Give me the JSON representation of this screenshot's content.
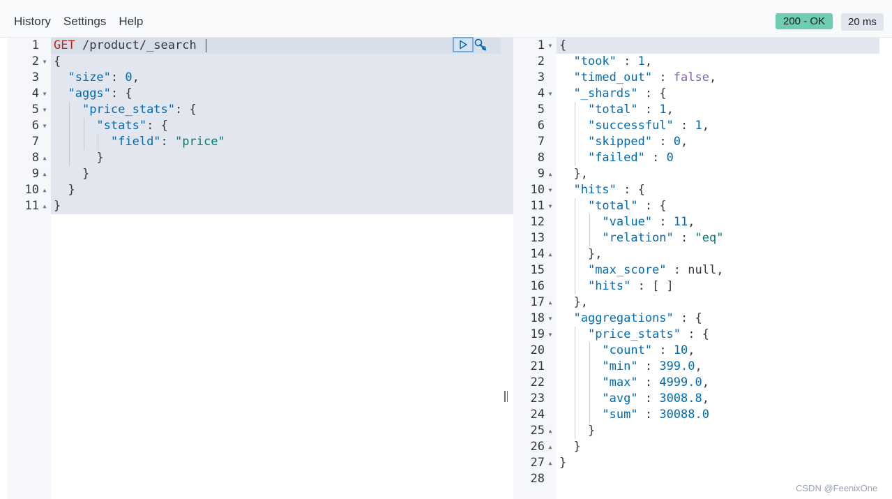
{
  "menu": {
    "items": [
      "History",
      "Settings",
      "Help"
    ]
  },
  "status": {
    "code": "200 - OK",
    "timing": "20 ms"
  },
  "request": {
    "method": "GET",
    "url": "/product/_search",
    "lines": [
      [
        [
          "method",
          "GET"
        ],
        [
          "p",
          " "
        ],
        [
          "url",
          "/product/_search"
        ]
      ],
      [
        [
          "p",
          "{"
        ]
      ],
      [
        [
          "p",
          "  "
        ],
        [
          "key",
          "\"size\""
        ],
        [
          "p",
          ": "
        ],
        [
          "num",
          "0"
        ],
        [
          "p",
          ","
        ]
      ],
      [
        [
          "p",
          "  "
        ],
        [
          "key",
          "\"aggs\""
        ],
        [
          "p",
          ": {"
        ]
      ],
      [
        [
          "p",
          "    "
        ],
        [
          "key",
          "\"price_stats\""
        ],
        [
          "p",
          ": {"
        ]
      ],
      [
        [
          "p",
          "      "
        ],
        [
          "key",
          "\"stats\""
        ],
        [
          "p",
          ": {"
        ]
      ],
      [
        [
          "p",
          "        "
        ],
        [
          "key",
          "\"field\""
        ],
        [
          "p",
          ": "
        ],
        [
          "str",
          "\"price\""
        ]
      ],
      [
        [
          "p",
          "      }"
        ]
      ],
      [
        [
          "p",
          "    }"
        ]
      ],
      [
        [
          "p",
          "  }"
        ]
      ],
      [
        [
          "p",
          "}"
        ]
      ]
    ],
    "folds": [
      "",
      "down",
      "",
      "down",
      "down",
      "down",
      "",
      "up",
      "up",
      "up",
      "up"
    ]
  },
  "response": {
    "lines": [
      [
        [
          "p",
          "{"
        ]
      ],
      [
        [
          "p",
          "  "
        ],
        [
          "key",
          "\"took\""
        ],
        [
          "p",
          " : "
        ],
        [
          "num",
          "1"
        ],
        [
          "p",
          ","
        ]
      ],
      [
        [
          "p",
          "  "
        ],
        [
          "key",
          "\"timed_out\""
        ],
        [
          "p",
          " : "
        ],
        [
          "bool",
          "false"
        ],
        [
          "p",
          ","
        ]
      ],
      [
        [
          "p",
          "  "
        ],
        [
          "key",
          "\"_shards\""
        ],
        [
          "p",
          " : {"
        ]
      ],
      [
        [
          "p",
          "    "
        ],
        [
          "key",
          "\"total\""
        ],
        [
          "p",
          " : "
        ],
        [
          "num",
          "1"
        ],
        [
          "p",
          ","
        ]
      ],
      [
        [
          "p",
          "    "
        ],
        [
          "key",
          "\"successful\""
        ],
        [
          "p",
          " : "
        ],
        [
          "num",
          "1"
        ],
        [
          "p",
          ","
        ]
      ],
      [
        [
          "p",
          "    "
        ],
        [
          "key",
          "\"skipped\""
        ],
        [
          "p",
          " : "
        ],
        [
          "num",
          "0"
        ],
        [
          "p",
          ","
        ]
      ],
      [
        [
          "p",
          "    "
        ],
        [
          "key",
          "\"failed\""
        ],
        [
          "p",
          " : "
        ],
        [
          "num",
          "0"
        ]
      ],
      [
        [
          "p",
          "  },"
        ]
      ],
      [
        [
          "p",
          "  "
        ],
        [
          "key",
          "\"hits\""
        ],
        [
          "p",
          " : {"
        ]
      ],
      [
        [
          "p",
          "    "
        ],
        [
          "key",
          "\"total\""
        ],
        [
          "p",
          " : {"
        ]
      ],
      [
        [
          "p",
          "      "
        ],
        [
          "key",
          "\"value\""
        ],
        [
          "p",
          " : "
        ],
        [
          "num",
          "11"
        ],
        [
          "p",
          ","
        ]
      ],
      [
        [
          "p",
          "      "
        ],
        [
          "key",
          "\"relation\""
        ],
        [
          "p",
          " : "
        ],
        [
          "str",
          "\"eq\""
        ]
      ],
      [
        [
          "p",
          "    },"
        ]
      ],
      [
        [
          "p",
          "    "
        ],
        [
          "key",
          "\"max_score\""
        ],
        [
          "p",
          " : "
        ],
        [
          "null",
          "null"
        ],
        [
          "p",
          ","
        ]
      ],
      [
        [
          "p",
          "    "
        ],
        [
          "key",
          "\"hits\""
        ],
        [
          "p",
          " : [ ]"
        ]
      ],
      [
        [
          "p",
          "  },"
        ]
      ],
      [
        [
          "p",
          "  "
        ],
        [
          "key",
          "\"aggregations\""
        ],
        [
          "p",
          " : {"
        ]
      ],
      [
        [
          "p",
          "    "
        ],
        [
          "key",
          "\"price_stats\""
        ],
        [
          "p",
          " : {"
        ]
      ],
      [
        [
          "p",
          "      "
        ],
        [
          "key",
          "\"count\""
        ],
        [
          "p",
          " : "
        ],
        [
          "num",
          "10"
        ],
        [
          "p",
          ","
        ]
      ],
      [
        [
          "p",
          "      "
        ],
        [
          "key",
          "\"min\""
        ],
        [
          "p",
          " : "
        ],
        [
          "num",
          "399.0"
        ],
        [
          "p",
          ","
        ]
      ],
      [
        [
          "p",
          "      "
        ],
        [
          "key",
          "\"max\""
        ],
        [
          "p",
          " : "
        ],
        [
          "num",
          "4999.0"
        ],
        [
          "p",
          ","
        ]
      ],
      [
        [
          "p",
          "      "
        ],
        [
          "key",
          "\"avg\""
        ],
        [
          "p",
          " : "
        ],
        [
          "num",
          "3008.8"
        ],
        [
          "p",
          ","
        ]
      ],
      [
        [
          "p",
          "      "
        ],
        [
          "key",
          "\"sum\""
        ],
        [
          "p",
          " : "
        ],
        [
          "num",
          "30088.0"
        ]
      ],
      [
        [
          "p",
          "    }"
        ]
      ],
      [
        [
          "p",
          "  }"
        ]
      ],
      [
        [
          "p",
          "}"
        ]
      ],
      []
    ],
    "folds": [
      "down",
      "",
      "",
      "down",
      "",
      "",
      "",
      "",
      "up",
      "down",
      "down",
      "",
      "",
      "up",
      "",
      "",
      "up",
      "down",
      "down",
      "",
      "",
      "",
      "",
      "",
      "up",
      "up",
      "up",
      ""
    ]
  },
  "icons": {
    "run": "play-icon",
    "settings": "wrench-icon"
  },
  "watermark": "CSDN @FeenixOne"
}
